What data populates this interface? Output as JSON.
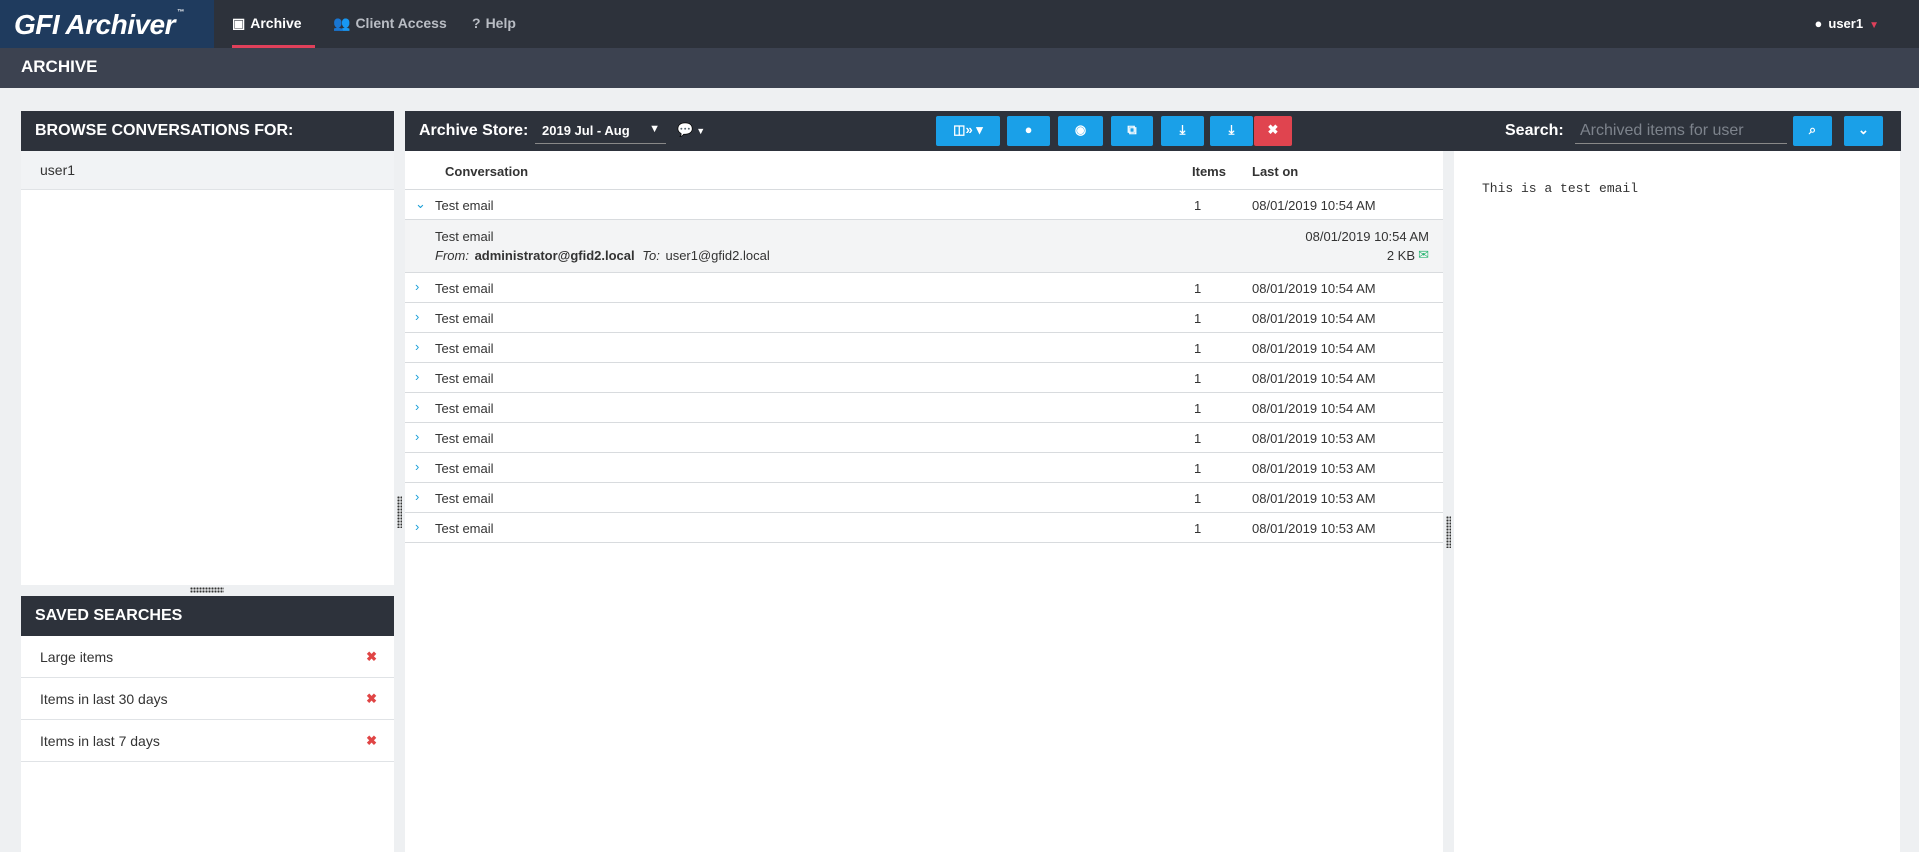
{
  "app": {
    "logo_text": "GFI Archiver",
    "logo_tm": "™"
  },
  "nav": {
    "tabs": [
      {
        "label": "Archive",
        "icon": "archive-icon",
        "active": true
      },
      {
        "label": "Client Access",
        "icon": "users-icon",
        "active": false
      },
      {
        "label": "Help",
        "icon": "question-icon",
        "active": false
      }
    ],
    "user": "user1"
  },
  "page": {
    "title": "ARCHIVE"
  },
  "browse": {
    "title": "BROWSE CONVERSATIONS FOR:",
    "items": [
      "user1"
    ]
  },
  "saved_searches": {
    "title": "SAVED SEARCHES",
    "items": [
      "Large items",
      "Items in last 30 days",
      "Items in last 7 days"
    ]
  },
  "toolbar": {
    "store_label": "Archive Store:",
    "store_value": "2019 Jul - Aug",
    "buttons": [
      {
        "name": "columns-button",
        "icon": "columns-icon"
      },
      {
        "name": "user-button",
        "icon": "user-icon"
      },
      {
        "name": "view-button",
        "icon": "eye-icon"
      },
      {
        "name": "popout-button",
        "icon": "windows-icon"
      },
      {
        "name": "download-button",
        "icon": "download-icon"
      },
      {
        "name": "restore-button",
        "icon": "download-icon"
      },
      {
        "name": "delete-button",
        "icon": "close-icon"
      }
    ],
    "search_label": "Search:",
    "search_placeholder": "Archived items for user"
  },
  "list": {
    "columns": {
      "conversation": "Conversation",
      "items": "Items",
      "last_on": "Last on"
    },
    "expanded": {
      "subject": "Test email",
      "from_label": "From:",
      "from": "administrator@gfid2.local",
      "to_label": "To:",
      "to": "user1@gfid2.local",
      "date": "08/01/2019 10:54 AM",
      "size": "2 KB"
    },
    "rows": [
      {
        "subject": "Test email",
        "items": "1",
        "last_on": "08/01/2019 10:54 AM"
      },
      {
        "subject": "Test email",
        "items": "1",
        "last_on": "08/01/2019 10:54 AM"
      },
      {
        "subject": "Test email",
        "items": "1",
        "last_on": "08/01/2019 10:54 AM"
      },
      {
        "subject": "Test email",
        "items": "1",
        "last_on": "08/01/2019 10:54 AM"
      },
      {
        "subject": "Test email",
        "items": "1",
        "last_on": "08/01/2019 10:54 AM"
      },
      {
        "subject": "Test email",
        "items": "1",
        "last_on": "08/01/2019 10:54 AM"
      },
      {
        "subject": "Test email",
        "items": "1",
        "last_on": "08/01/2019 10:53 AM"
      },
      {
        "subject": "Test email",
        "items": "1",
        "last_on": "08/01/2019 10:53 AM"
      },
      {
        "subject": "Test email",
        "items": "1",
        "last_on": "08/01/2019 10:53 AM"
      },
      {
        "subject": "Test email",
        "items": "1",
        "last_on": "08/01/2019 10:53 AM"
      }
    ]
  },
  "preview": {
    "body": "This is a test email"
  },
  "colors": {
    "accent": "#1aa0e8",
    "danger": "#e0444f",
    "nav_bg": "#2d323b",
    "active_underline": "#e0405a"
  }
}
